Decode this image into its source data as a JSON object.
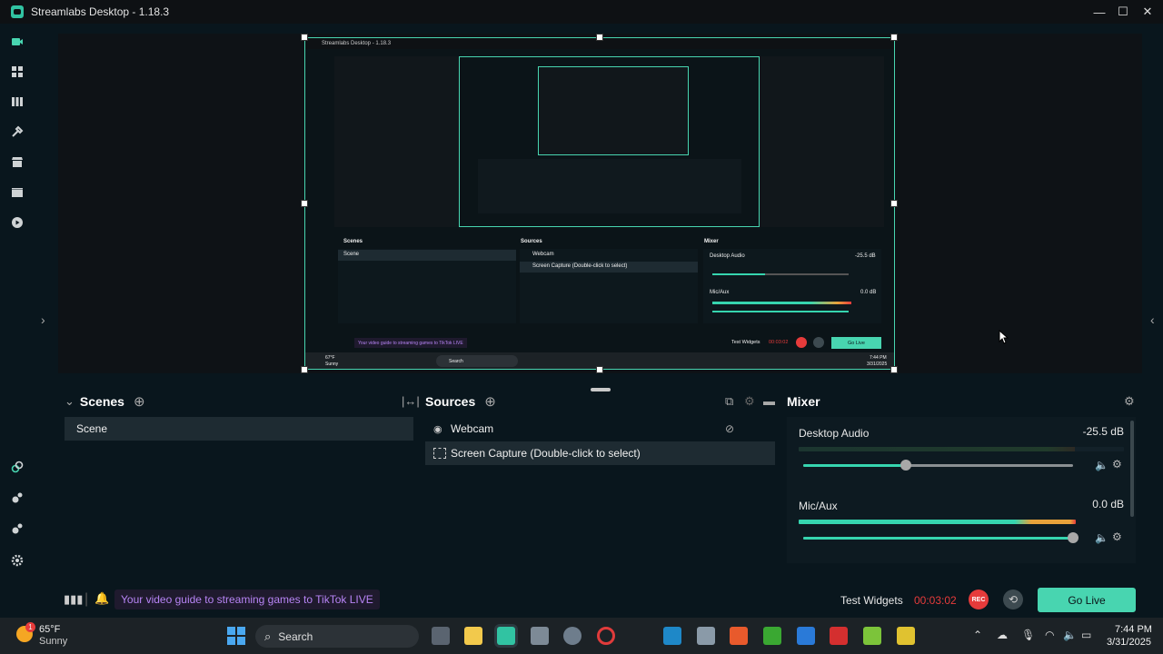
{
  "window": {
    "title": "Streamlabs Desktop - 1.18.3",
    "minimize": "—",
    "maximize": "☐",
    "close": "✕"
  },
  "capture": {
    "title": "Streamlabs Desktop - 1.18.3",
    "scenes_label": "Scenes",
    "scene": "Scene",
    "sources_label": "Sources",
    "webcam": "Webcam",
    "screen": "Screen Capture (Double-click to select)",
    "mixer_label": "Mixer",
    "desktop_audio": "Desktop Audio",
    "desktop_db": "-25.5 dB",
    "mic": "Mic/Aux",
    "mic_db": "0.0 dB",
    "guide": "Your video guide to streaming games to TikTok LIVE",
    "test_widgets": "Test Widgets",
    "timer": "00:03:02",
    "go_live": "Go Live",
    "weather_temp": "67°F",
    "weather_cond": "Sunny",
    "search": "Search",
    "clock_time": "7:44 PM",
    "clock_date": "3/31/2025"
  },
  "scenes": {
    "title": "Scenes",
    "items": [
      "Scene"
    ]
  },
  "sources": {
    "title": "Sources",
    "items": [
      {
        "name": "Webcam",
        "icon": "webcam-icon"
      },
      {
        "name": "Screen Capture (Double-click to select)",
        "icon": "screen-capture-icon"
      }
    ]
  },
  "mixer": {
    "title": "Mixer",
    "channels": [
      {
        "name": "Desktop Audio",
        "db": "-25.5 dB",
        "meter_level": 0.0,
        "volume": 0.38
      },
      {
        "name": "Mic/Aux",
        "db": "0.0 dB",
        "meter_level": 0.98,
        "volume": 1.0
      }
    ]
  },
  "footer": {
    "guide": "Your video guide to streaming games to TikTok LIVE",
    "test_widgets": "Test Widgets",
    "timer": "00:03:02",
    "rec": "REC",
    "go_live": "Go Live"
  },
  "taskbar": {
    "weather_temp": "65°F",
    "weather_cond": "Sunny",
    "weather_badge": "1",
    "search": "Search",
    "time": "7:44 PM",
    "date": "3/31/2025"
  },
  "colors": {
    "accent": "#48d5b0",
    "rec": "#e63b3b",
    "guide_text": "#b784f5",
    "timer": "#e63b3b"
  }
}
